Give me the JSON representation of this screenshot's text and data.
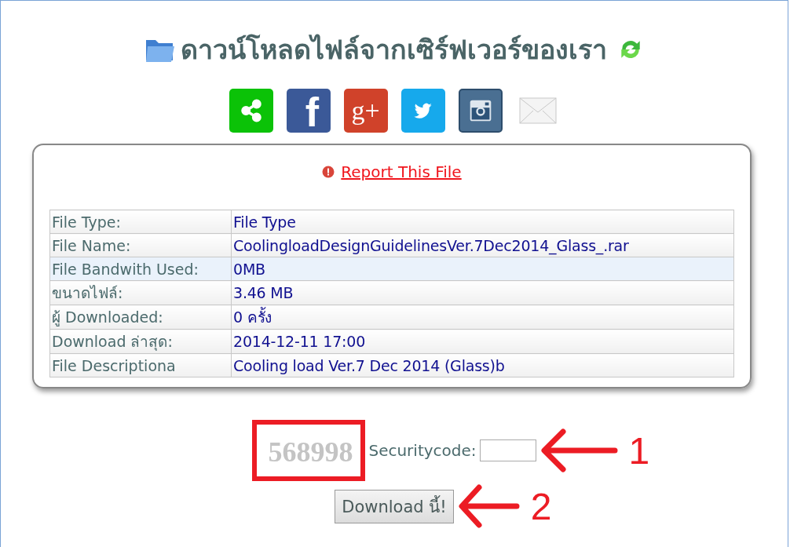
{
  "title": "ดาวน์โหลดไฟล์จากเซิร์ฟเวอร์ของเรา",
  "share_buttons": [
    {
      "kind": "share"
    },
    {
      "kind": "facebook",
      "glyph": "f"
    },
    {
      "kind": "google_plus",
      "glyph": "g+"
    },
    {
      "kind": "twitter"
    },
    {
      "kind": "instagram"
    },
    {
      "kind": "email"
    }
  ],
  "report_link": "Report This File",
  "file_info": [
    {
      "label": "File Type:",
      "value": "File Type",
      "highlighted": false
    },
    {
      "label": "File Name:",
      "value": "CoolingloadDesignGuidelinesVer.7Dec2014_Glass_.rar",
      "highlighted": false
    },
    {
      "label": "File Bandwith Used:",
      "value": "0MB",
      "highlighted": true
    },
    {
      "label": "ขนาดไฟล์:",
      "value": "3.46 MB",
      "highlighted": false
    },
    {
      "label": "ผู้ Downloaded:",
      "value": "0 ครั้ง",
      "highlighted": false
    },
    {
      "label": "Download ล่าสุด:",
      "value": "2014-12-11 17:00",
      "highlighted": false
    },
    {
      "label": "File Descriptiona",
      "value": "Cooling load Ver.7 Dec 2014 (Glass)b",
      "highlighted": false
    }
  ],
  "captcha": {
    "code": "568998",
    "highlighted": true
  },
  "security_label": "Securitycode:",
  "download_button": "Download นี้!",
  "annotations": [
    {
      "label": "1"
    },
    {
      "label": "2"
    }
  ]
}
